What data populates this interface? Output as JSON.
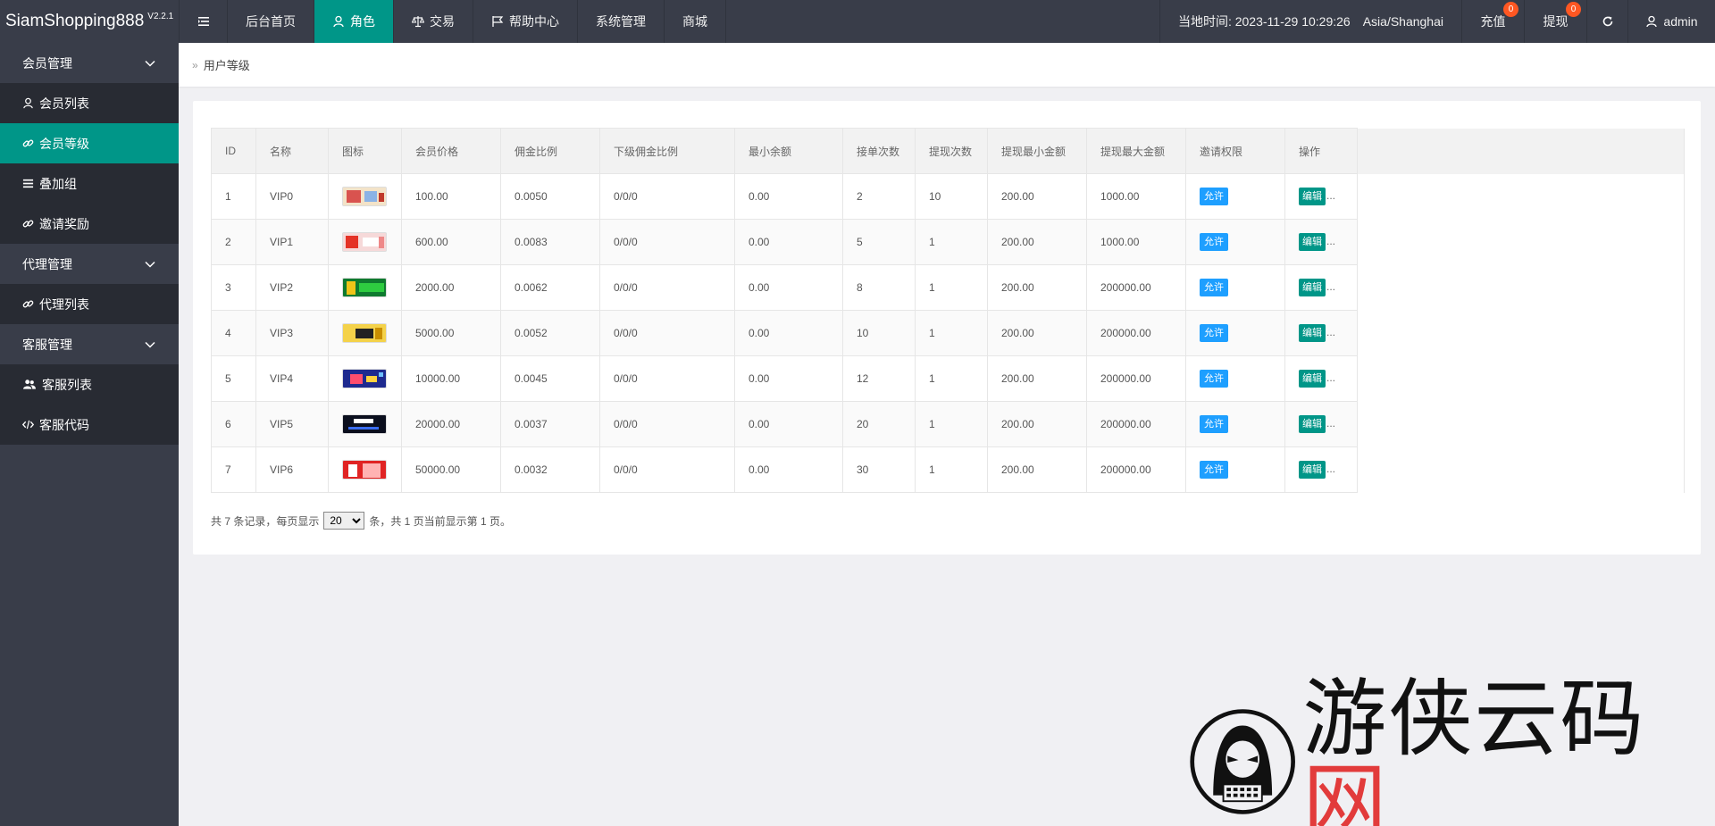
{
  "app": {
    "brand": "SiamShopping888",
    "version": "V2.2.1"
  },
  "top_nav": [
    {
      "label": "后台首页",
      "icon": ""
    },
    {
      "label": "角色",
      "icon": "user-icon",
      "active": true
    },
    {
      "label": "交易",
      "icon": "scale-icon"
    },
    {
      "label": "帮助中心",
      "icon": "flag-icon"
    },
    {
      "label": "系统管理",
      "icon": ""
    },
    {
      "label": "商城",
      "icon": ""
    }
  ],
  "header_right": {
    "time_label": "当地时间: 2023-11-29 10:29:26",
    "timezone": "Asia/Shanghai",
    "recharge_label": "充值",
    "recharge_badge": "0",
    "withdraw_label": "提现",
    "withdraw_badge": "0",
    "user": "admin"
  },
  "sidebar": {
    "groups": [
      {
        "label": "会员管理",
        "items": [
          {
            "label": "会员列表",
            "icon": "user-icon"
          },
          {
            "label": "会员等级",
            "icon": "link-icon",
            "active": true
          },
          {
            "label": "叠加组",
            "icon": "list-icon"
          },
          {
            "label": "邀请奖励",
            "icon": "link-icon"
          }
        ]
      },
      {
        "label": "代理管理",
        "items": [
          {
            "label": "代理列表",
            "icon": "link-icon"
          }
        ]
      },
      {
        "label": "客服管理",
        "items": [
          {
            "label": "客服列表",
            "icon": "users-icon"
          },
          {
            "label": "客服代码",
            "icon": "code-icon"
          }
        ]
      }
    ]
  },
  "breadcrumb": {
    "current": "用户等级"
  },
  "table": {
    "columns": [
      "ID",
      "名称",
      "图标",
      "会员价格",
      "佣金比例",
      "下级佣金比例",
      "最小余额",
      "接单次数",
      "提现次数",
      "提现最小金额",
      "提现最大金额",
      "邀请权限",
      "操作"
    ],
    "rows": [
      {
        "id": "1",
        "name": "VIP0",
        "thumb": "shop-thumb",
        "price": "100.00",
        "commission": "0.0050",
        "sub_commission": "0/0/0",
        "min_balance": "0.00",
        "orders": "2",
        "withdraw_times": "10",
        "withdraw_min": "200.00",
        "withdraw_max": "1000.00",
        "invite": "允许",
        "edit": "编辑",
        "more": "..."
      },
      {
        "id": "2",
        "name": "VIP1",
        "thumb": "aliexpress-thumb",
        "price": "600.00",
        "commission": "0.0083",
        "sub_commission": "0/0/0",
        "min_balance": "0.00",
        "orders": "5",
        "withdraw_times": "1",
        "withdraw_min": "200.00",
        "withdraw_max": "1000.00",
        "invite": "允许",
        "edit": "编辑",
        "more": "..."
      },
      {
        "id": "3",
        "name": "VIP2",
        "thumb": "green-thumb",
        "price": "2000.00",
        "commission": "0.0062",
        "sub_commission": "0/0/0",
        "min_balance": "0.00",
        "orders": "8",
        "withdraw_times": "1",
        "withdraw_min": "200.00",
        "withdraw_max": "200000.00",
        "invite": "允许",
        "edit": "编辑",
        "more": "..."
      },
      {
        "id": "4",
        "name": "VIP3",
        "thumb": "yellow-thumb",
        "price": "5000.00",
        "commission": "0.0052",
        "sub_commission": "0/0/0",
        "min_balance": "0.00",
        "orders": "10",
        "withdraw_times": "1",
        "withdraw_min": "200.00",
        "withdraw_max": "200000.00",
        "invite": "允许",
        "edit": "编辑",
        "more": "..."
      },
      {
        "id": "5",
        "name": "VIP4",
        "thumb": "cart-thumb",
        "price": "10000.00",
        "commission": "0.0045",
        "sub_commission": "0/0/0",
        "min_balance": "0.00",
        "orders": "12",
        "withdraw_times": "1",
        "withdraw_min": "200.00",
        "withdraw_max": "200000.00",
        "invite": "允许",
        "edit": "编辑",
        "more": "..."
      },
      {
        "id": "6",
        "name": "VIP5",
        "thumb": "dark-thumb",
        "price": "20000.00",
        "commission": "0.0037",
        "sub_commission": "0/0/0",
        "min_balance": "0.00",
        "orders": "20",
        "withdraw_times": "1",
        "withdraw_min": "200.00",
        "withdraw_max": "200000.00",
        "invite": "允许",
        "edit": "编辑",
        "more": "..."
      },
      {
        "id": "7",
        "name": "VIP6",
        "thumb": "red-thumb",
        "price": "50000.00",
        "commission": "0.0032",
        "sub_commission": "0/0/0",
        "min_balance": "0.00",
        "orders": "30",
        "withdraw_times": "1",
        "withdraw_min": "200.00",
        "withdraw_max": "200000.00",
        "invite": "允许",
        "edit": "编辑",
        "more": "..."
      }
    ]
  },
  "pager": {
    "prefix": "共 7 条记录，每页显示",
    "page_size": "20",
    "suffix": "条，共 1 页当前显示第 1 页。"
  },
  "watermark": {
    "text_a": "游侠云码",
    "text_b": "网"
  },
  "colors": {
    "header_bg": "#393d49",
    "accent": "#009688",
    "allow_blue": "#1e9fff",
    "badge": "#ff5722"
  }
}
